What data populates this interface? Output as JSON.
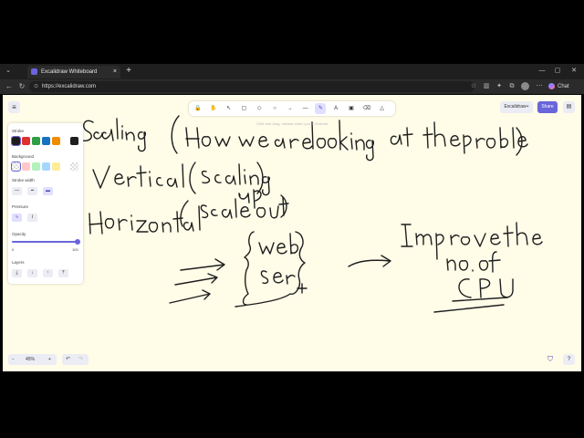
{
  "browser": {
    "tab_title": "Excalidraw Whiteboard",
    "new_tab_icon": "plus-icon",
    "url": "https://excalidraw.com",
    "chat_label": "Chat",
    "window_controls": [
      "minimize",
      "maximize",
      "close"
    ]
  },
  "toolbar": {
    "tools": [
      {
        "name": "lock",
        "icon": "🔒",
        "active": false
      },
      {
        "name": "hand",
        "icon": "✋",
        "active": false
      },
      {
        "name": "selection",
        "icon": "↖",
        "active": false
      },
      {
        "name": "rectangle",
        "icon": "▢",
        "active": false
      },
      {
        "name": "diamond",
        "icon": "◇",
        "active": false
      },
      {
        "name": "ellipse",
        "icon": "○",
        "active": false
      },
      {
        "name": "arrow",
        "icon": "→",
        "active": false
      },
      {
        "name": "line",
        "icon": "—",
        "active": false
      },
      {
        "name": "draw",
        "icon": "✎",
        "active": true
      },
      {
        "name": "text",
        "icon": "A",
        "active": false
      },
      {
        "name": "image",
        "icon": "▣",
        "active": false
      },
      {
        "name": "eraser",
        "icon": "⌫",
        "active": false
      },
      {
        "name": "more",
        "icon": "△",
        "active": false
      }
    ],
    "hint": "Click and drag, release when you're finished"
  },
  "header": {
    "excalidraw_plus_label": "Excalidraw+",
    "share_label": "Share"
  },
  "properties": {
    "stroke_label": "Stroke",
    "stroke_colors": [
      "#1e1e1e",
      "#e03131",
      "#2f9e44",
      "#1971c2",
      "#f08c00"
    ],
    "stroke_selected": "#1e1e1e",
    "background_label": "Background",
    "background_colors": [
      "transparent",
      "#ffc9c9",
      "#b2f2bb",
      "#a5d8ff",
      "#ffec99"
    ],
    "stroke_width_label": "Stroke width",
    "pressure_label": "Pressure",
    "opacity_label": "Opacity",
    "opacity_min": "0",
    "opacity_max": "100",
    "opacity_value": 100,
    "layers_label": "Layers"
  },
  "footer": {
    "zoom_out": "−",
    "zoom_level": "45%",
    "zoom_in": "+",
    "undo": "↶",
    "redo": "↷",
    "help": "?"
  },
  "drawing": {
    "words": [
      "Scaling",
      "(How we are looking at the problem)",
      "Vertical (scaling up)",
      "Horizontal (scale out)",
      "Web server",
      "Improve the no. of CPU"
    ]
  }
}
